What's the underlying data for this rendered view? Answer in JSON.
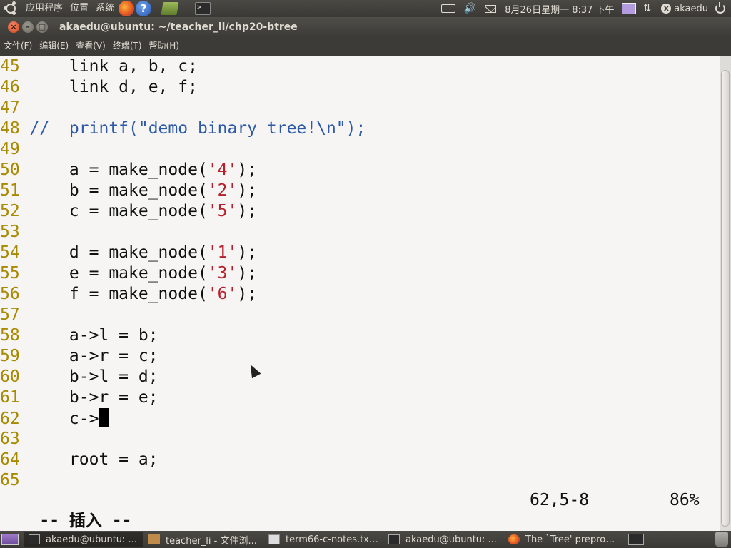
{
  "top_panel": {
    "menus": [
      "应用程序",
      "位置",
      "系统"
    ],
    "clock": "8月26日星期一  8:37 下午",
    "user": "akaedu"
  },
  "window": {
    "title": "akaedu@ubuntu: ~/teacher_li/chp20-btree",
    "menu": [
      "文件(F)",
      "编辑(E)",
      "查看(V)",
      "终端(T)",
      "帮助(H)"
    ]
  },
  "editor": {
    "lines": [
      {
        "num": "45",
        "code": "    link a, b, c;"
      },
      {
        "num": "46",
        "code": "    link d, e, f;"
      },
      {
        "num": "47",
        "code": ""
      },
      {
        "num": "48",
        "comment": "//  printf(\"demo binary tree!\\n\");"
      },
      {
        "num": "49",
        "code": ""
      },
      {
        "num": "50",
        "pre": "    a = make_node(",
        "char": "'4'",
        "post": ");"
      },
      {
        "num": "51",
        "pre": "    b = make_node(",
        "char": "'2'",
        "post": ");"
      },
      {
        "num": "52",
        "pre": "    c = make_node(",
        "char": "'5'",
        "post": ");"
      },
      {
        "num": "53",
        "code": ""
      },
      {
        "num": "54",
        "pre": "    d = make_node(",
        "char": "'1'",
        "post": ");"
      },
      {
        "num": "55",
        "pre": "    e = make_node(",
        "char": "'3'",
        "post": ");"
      },
      {
        "num": "56",
        "pre": "    f = make_node(",
        "char": "'6'",
        "post": ");"
      },
      {
        "num": "57",
        "code": ""
      },
      {
        "num": "58",
        "code": "    a->l = b;"
      },
      {
        "num": "59",
        "code": "    a->r = c;"
      },
      {
        "num": "60",
        "code": "    b->l = d;"
      },
      {
        "num": "61",
        "code": "    b->r = e;"
      },
      {
        "num": "62",
        "code": "    c->",
        "cursor": true
      },
      {
        "num": "63",
        "code": ""
      },
      {
        "num": "64",
        "code": "    root = a;"
      },
      {
        "num": "65",
        "code": ""
      }
    ],
    "mode": "-- 插入 --",
    "position": "62,5-8",
    "percent": "86%"
  },
  "taskbar": {
    "tasks": [
      {
        "label": "akaedu@ubuntu: ...",
        "icon": "terminal-icon",
        "active": true
      },
      {
        "label": "teacher_li - 文件浏...",
        "icon": "folder-icon",
        "active": false
      },
      {
        "label": "term66-c-notes.txt-...",
        "icon": "text-editor-icon",
        "active": false
      },
      {
        "label": "akaedu@ubuntu: ...",
        "icon": "terminal-icon",
        "active": false
      },
      {
        "label": "The `Tree' preproc...",
        "icon": "firefox-icon",
        "active": false
      }
    ]
  }
}
